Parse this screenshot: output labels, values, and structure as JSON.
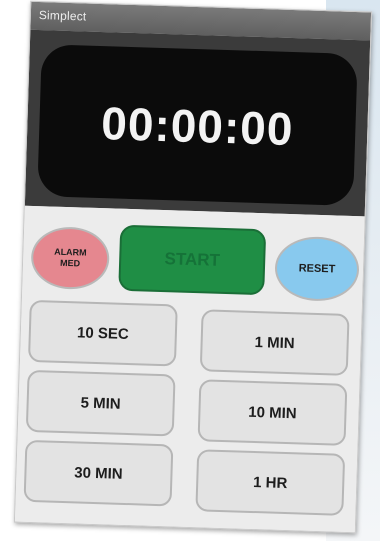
{
  "app": {
    "title": "Simplect"
  },
  "timer": {
    "display": "00:00:00"
  },
  "controls": {
    "alarm_line1": "ALARM",
    "alarm_line2": "MED",
    "start": "START",
    "reset": "RESET"
  },
  "presets": [
    "10 SEC",
    "1 MIN",
    "5 MIN",
    "10 MIN",
    "30 MIN",
    "1 HR"
  ],
  "colors": {
    "titlebar": "#6b6b6b",
    "display_background": "#0b0b0b",
    "alarm": "#e5878f",
    "start": "#1f8e45",
    "reset": "#88c9ee",
    "preset": "#e3e3e3"
  }
}
